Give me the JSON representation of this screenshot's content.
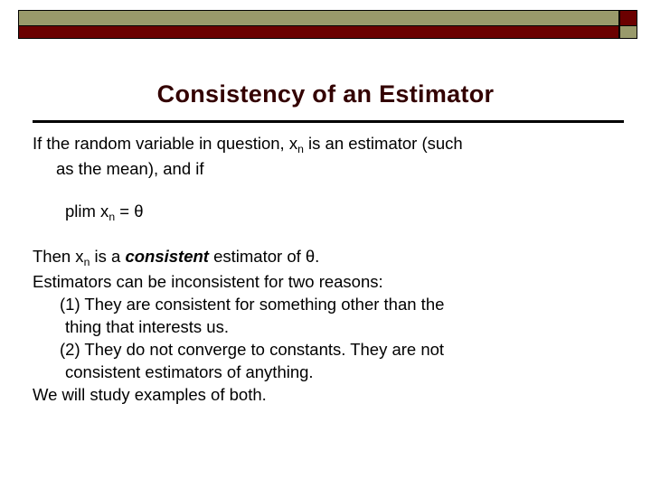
{
  "colors": {
    "banner_olive": "#999a6b",
    "banner_maroon": "#6b0000",
    "title_color": "#330000",
    "body_color": "#000000",
    "background": "#ffffff"
  },
  "header": {
    "banner_name": "decorative-banner"
  },
  "title": {
    "text": "Consistency of an Estimator"
  },
  "body": {
    "intro": {
      "line1": "If the random variable in question, x",
      "line1_sub": "n",
      "line1_rest": " is an estimator (such",
      "line2": "as the mean), and if"
    },
    "equation": {
      "prefix": "plim x",
      "sub": "n",
      "suffix": " = θ"
    },
    "then_line": {
      "before": "Then x",
      "sub": "n",
      "mid": " is a ",
      "emphasis": "consistent",
      "after": " estimator of θ."
    },
    "reasons_intro": "Estimators can be inconsistent for two reasons:",
    "reason1": {
      "line1": "(1) They are consistent for something other than the",
      "line2": "thing that interests us."
    },
    "reason2": {
      "line1": "(2)  They do not converge to constants.  They are not",
      "line2": "consistent estimators of anything."
    },
    "closing": "We will study examples of both."
  }
}
